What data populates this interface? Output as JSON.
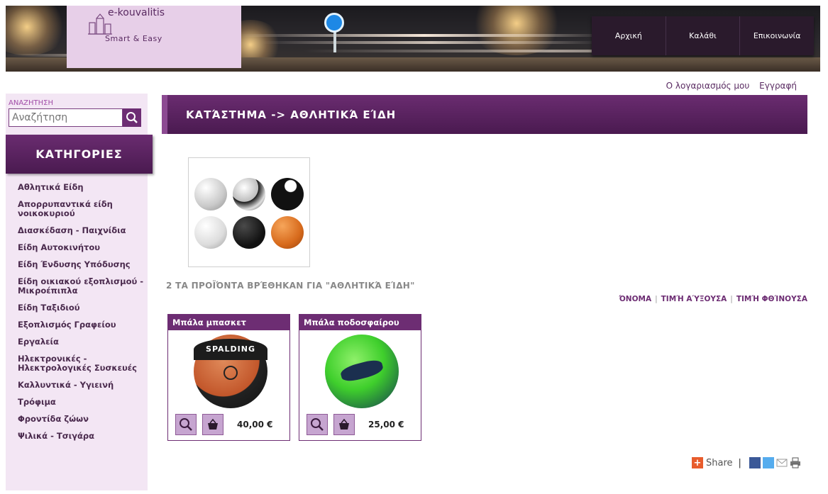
{
  "header": {
    "logo_title": "e-kouvalitis",
    "logo_tagline": "Smart & Easy",
    "nav": [
      "Αρχική",
      "Καλάθι",
      "Επικοινωνία"
    ]
  },
  "account": {
    "my_account": "Ο λογαριασμός μου",
    "register": "Εγγραφή"
  },
  "search": {
    "label": "ΑΝΑΖΗΤΗΣΗ",
    "placeholder": "Αναζήτηση"
  },
  "sidebar": {
    "categories_title": "ΚΑΤΗΓΟΡΙΕΣ",
    "categories": [
      "Αθλητικά Είδη",
      "Απορρυπαντικά είδη νοικοκυριού",
      "Διασκέδαση - Παιχνίδια",
      "Είδη Αυτοκινήτου",
      "Είδη Ένδυσης Υπόδυσης",
      "Είδη οικιακού εξοπλισμού - Μικροέπιπλα",
      "Είδη Ταξιδιού",
      "Εξοπλισμός Γραφείου",
      "Εργαλεία",
      "Ηλεκτρονικές - Ηλεκτρολογικές Συσκευές",
      "Καλλυντικά - Υγιεινή",
      "Τρόφιμα",
      "Φροντίδα ζώων",
      "Ψιλικά - Τσιγάρα"
    ]
  },
  "main": {
    "title": "ΚΑΤΆΣΤΗΜΑ -> ΑΘΛΗΤΙΚΆ ΕΊΔΗ",
    "results_text": "2 ΤΑ ΠΡΟΪΌΝΤΑ ΒΡΈΘΗΚΑΝ ΓΙΑ \"ΑΘΛΗΤΙΚΆ ΕΊΔΗ\"",
    "sort": [
      "ΌΝΟΜΑ",
      "ΤΙΜΉ ΑΎΞΟΥΣΑ",
      "ΤΙΜΉ ΦΘΊΝΟΥΣΑ"
    ],
    "products": [
      {
        "name": "Μπάλα μπασκετ",
        "price": "40,00 €",
        "image_text": "SPALDING"
      },
      {
        "name": "Μπάλα ποδοσφαίρου",
        "price": "25,00 €"
      }
    ]
  },
  "share": {
    "label": "Share"
  },
  "colors": {
    "primary": "#6d2d73",
    "sidebar_bg": "#f3e6f4",
    "logo_bg": "#e7cfe8"
  }
}
